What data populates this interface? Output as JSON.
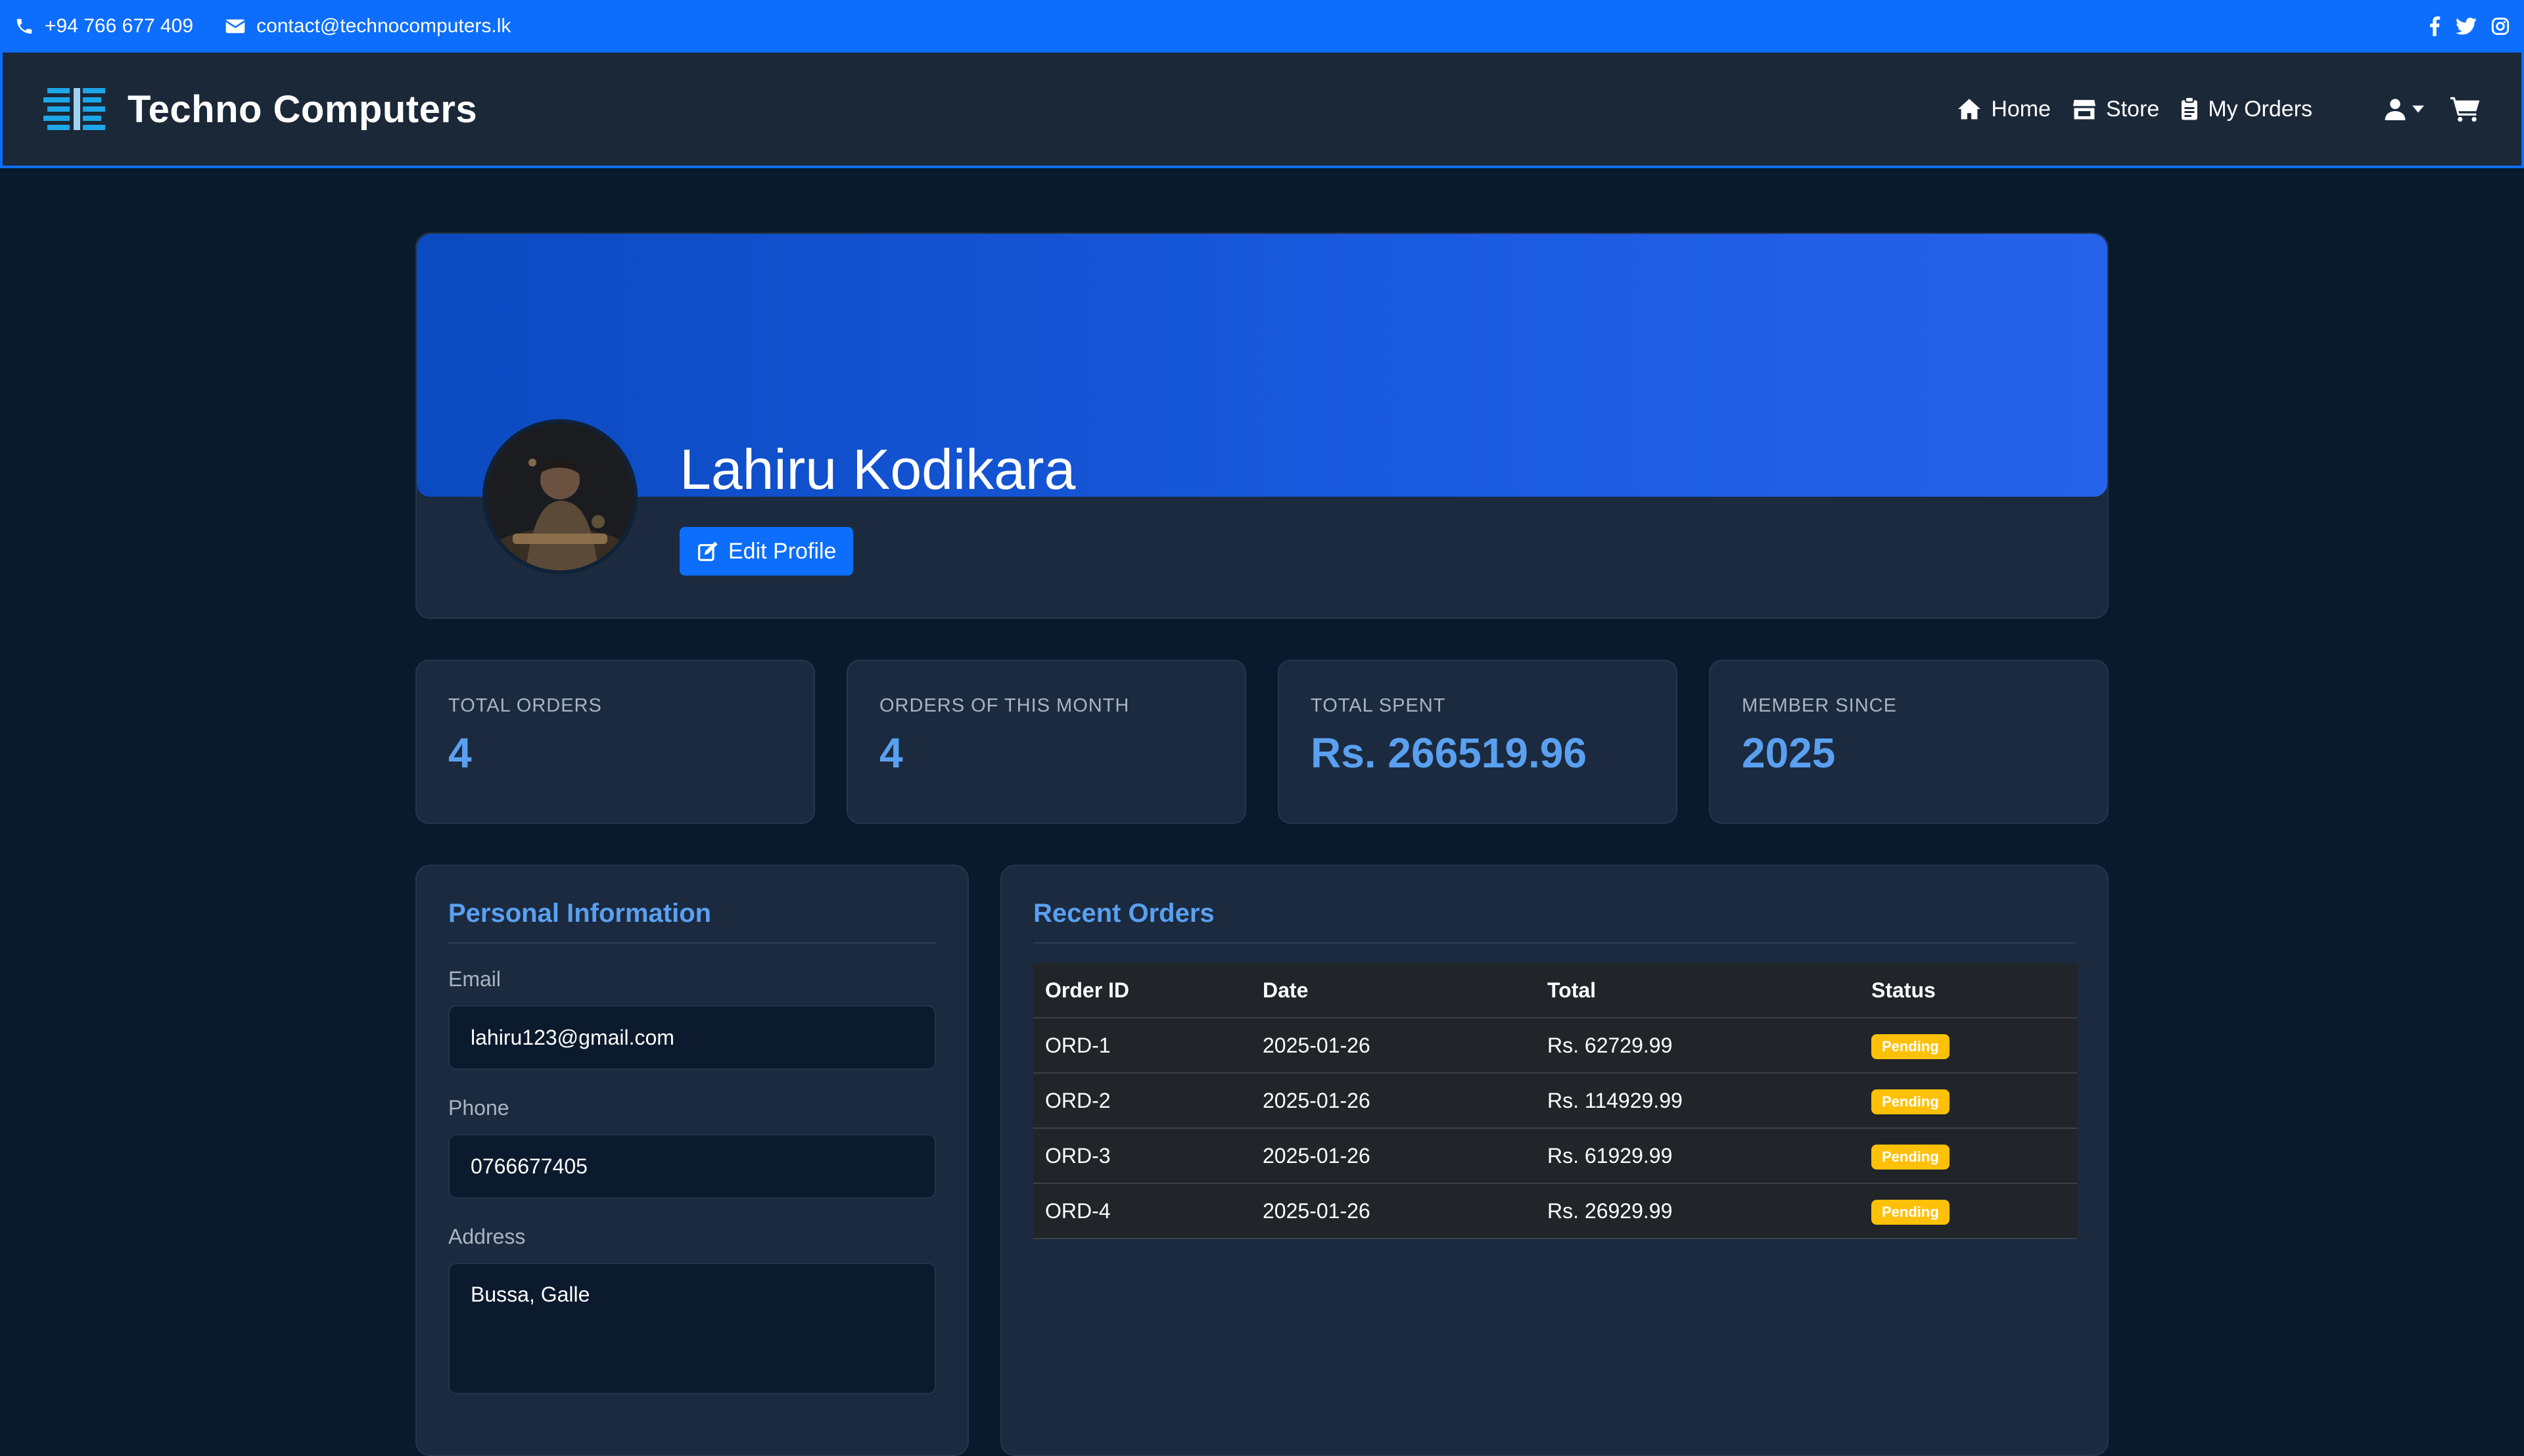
{
  "topbar": {
    "phone": "+94 766 677 409",
    "email": "contact@technocomputers.lk",
    "social": [
      "facebook-icon",
      "twitter-icon",
      "instagram-icon"
    ]
  },
  "navbar": {
    "brand": "Techno Computers",
    "links": [
      {
        "label": "Home",
        "icon": "home-icon"
      },
      {
        "label": "Store",
        "icon": "store-icon"
      },
      {
        "label": "My Orders",
        "icon": "clipboard-icon"
      }
    ]
  },
  "profile": {
    "name": "Lahiru Kodikara",
    "edit_label": "Edit Profile"
  },
  "stats": [
    {
      "label": "TOTAL ORDERS",
      "value": "4"
    },
    {
      "label": "ORDERS OF THIS MONTH",
      "value": "4"
    },
    {
      "label": "TOTAL SPENT",
      "value": "Rs. 266519.96"
    },
    {
      "label": "MEMBER SINCE",
      "value": "2025"
    }
  ],
  "personal": {
    "title": "Personal Information",
    "email_label": "Email",
    "email": "lahiru123@gmail.com",
    "phone_label": "Phone",
    "phone": "0766677405",
    "address_label": "Address",
    "address": "Bussa, Galle"
  },
  "orders": {
    "title": "Recent Orders",
    "columns": [
      "Order ID",
      "Date",
      "Total",
      "Status"
    ],
    "rows": [
      {
        "id": "ORD-1",
        "date": "2025-01-26",
        "total": "Rs. 62729.99",
        "status": "Pending"
      },
      {
        "id": "ORD-2",
        "date": "2025-01-26",
        "total": "Rs. 114929.99",
        "status": "Pending"
      },
      {
        "id": "ORD-3",
        "date": "2025-01-26",
        "total": "Rs. 61929.99",
        "status": "Pending"
      },
      {
        "id": "ORD-4",
        "date": "2025-01-26",
        "total": "Rs. 26929.99",
        "status": "Pending"
      }
    ]
  },
  "colors": {
    "accent": "#0d6efd",
    "background": "#091a2c",
    "card": "#1b2a3f",
    "highlight": "#5aa0f0",
    "pending": "#ffc107"
  }
}
